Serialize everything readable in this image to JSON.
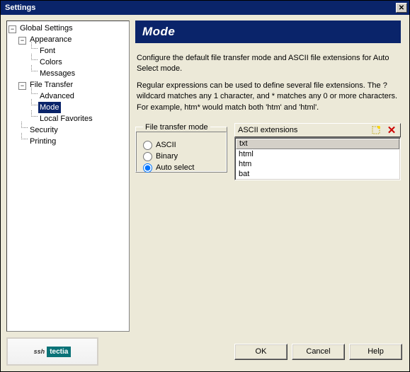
{
  "titlebar": {
    "title": "Settings"
  },
  "tree": {
    "root": "Global Settings",
    "appearance": {
      "label": "Appearance",
      "font": "Font",
      "colors": "Colors",
      "messages": "Messages"
    },
    "file_transfer": {
      "label": "File Transfer",
      "advanced": "Advanced",
      "mode": "Mode",
      "local_favorites": "Local Favorites"
    },
    "security": "Security",
    "printing": "Printing"
  },
  "main": {
    "title": "Mode",
    "desc1": "Configure the default file transfer mode and ASCII file extensions for Auto Select mode.",
    "desc2": "Regular expressions can be used to define several file extensions. The ? wildcard matches any 1 character, and * matches any 0 or more characters. For example, htm* would match both 'htm' and 'html'."
  },
  "transfer_mode": {
    "legend": "File transfer mode",
    "ascii": "ASCII",
    "binary": "Binary",
    "auto": "Auto select",
    "selected": "auto"
  },
  "ascii_ext": {
    "header": "ASCII extensions",
    "col": "txt",
    "items": [
      "html",
      "htm",
      "bat"
    ]
  },
  "logo": {
    "brand": "ssh",
    "product": "tectia"
  },
  "buttons": {
    "ok": "OK",
    "cancel": "Cancel",
    "help": "Help"
  }
}
